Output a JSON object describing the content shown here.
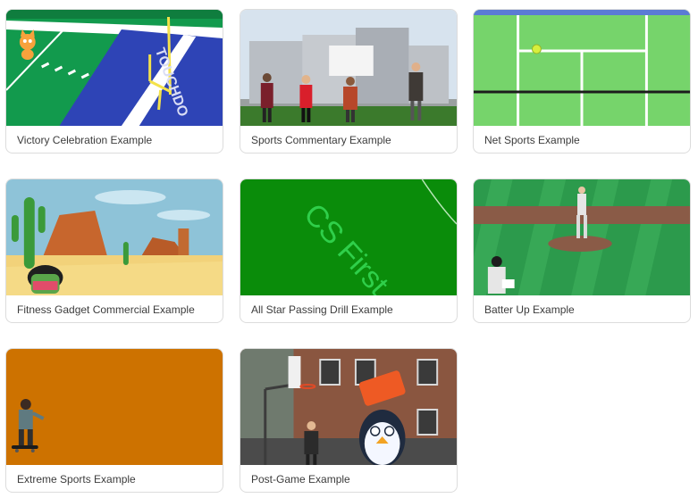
{
  "cards": [
    {
      "label": "Victory Celebration Example",
      "thumb_text": "TOUCHDO"
    },
    {
      "label": "Sports Commentary Example"
    },
    {
      "label": "Net Sports Example"
    },
    {
      "label": "Fitness Gadget Commercial Example"
    },
    {
      "label": "All Star Passing Drill Example",
      "thumb_text": "CS First"
    },
    {
      "label": "Batter Up Example"
    },
    {
      "label": "Extreme Sports Example"
    },
    {
      "label": "Post-Game Example"
    }
  ],
  "colors": {
    "field_green": "#129a4d",
    "endzone_blue": "#2e44b6",
    "court_green": "#76d46b",
    "chroma_green": "#0a8c0a",
    "orange_bg": "#cd7200",
    "accent_blue": "#5b7bd5"
  }
}
